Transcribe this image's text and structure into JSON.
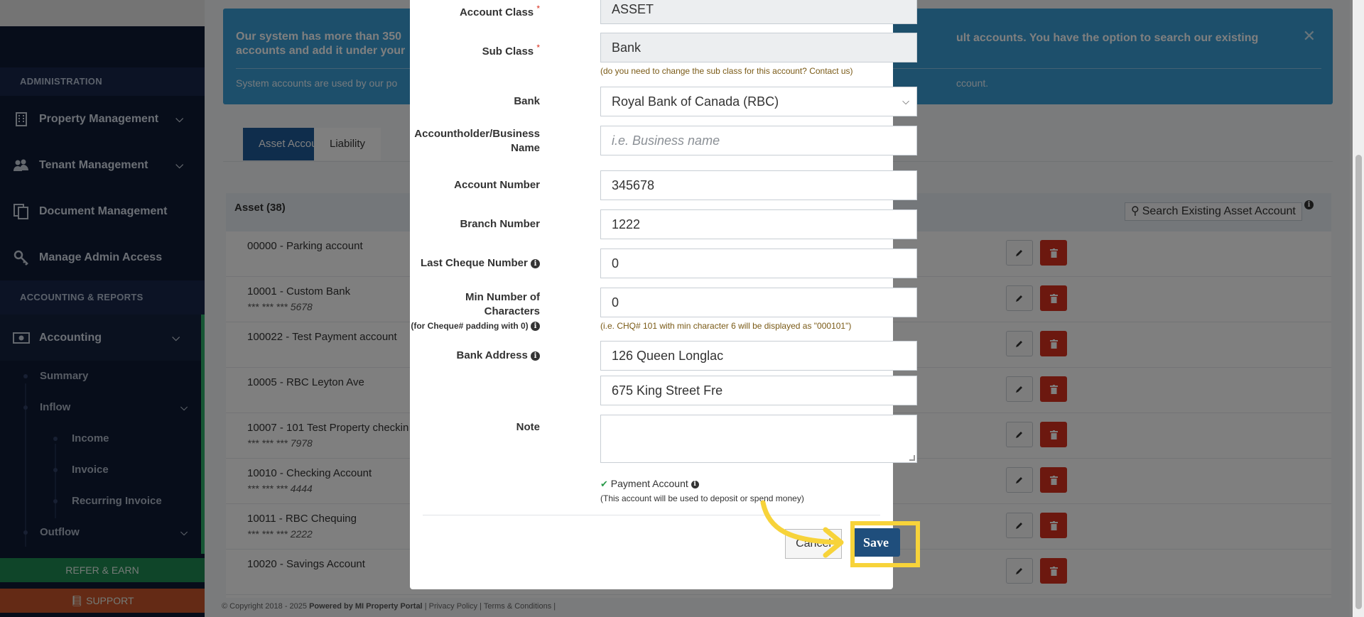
{
  "sidebar": {
    "admin_header": "ADMINISTRATION",
    "items": [
      {
        "label": "Property Management"
      },
      {
        "label": "Tenant Management"
      },
      {
        "label": "Document Management"
      },
      {
        "label": "Manage Admin Access"
      }
    ],
    "accounting_header": "ACCOUNTING & REPORTS",
    "accounting_label": "Accounting",
    "sub": {
      "summary": "Summary",
      "inflow": "Inflow",
      "income": "Income",
      "invoice": "Invoice",
      "recurring": "Recurring Invoice",
      "outflow": "Outflow"
    },
    "refer": "REFER & EARN",
    "support": "SUPPORT"
  },
  "alert": {
    "line1_left": "Our system has more than 350",
    "line1_left2": "accounts and add it under your",
    "line1_right": "ult accounts. You have the option to search our existing",
    "line2_left": "System accounts are used by our po",
    "line2_right": "ccount."
  },
  "tabs": {
    "asset": "Asset Accounts",
    "liability": "Liability"
  },
  "panel": {
    "title": "Asset (38)",
    "search": "Search Existing Asset Account",
    "rows": [
      {
        "name": "00000 - Parking account",
        "mask": ""
      },
      {
        "name": "10001 - Custom Bank",
        "mask": "*** *** *** 5678"
      },
      {
        "name": "100022 - Test Payment account",
        "mask": ""
      },
      {
        "name": "10005 - RBC Leyton Ave",
        "mask": ""
      },
      {
        "name": "10007 - 101 Test Property checkin",
        "mask": "*** *** *** 7978"
      },
      {
        "name": "10010 - Checking Account",
        "mask": "*** *** *** 4444"
      },
      {
        "name": "10011 - RBC Chequing",
        "mask": "*** *** *** 2222"
      },
      {
        "name": "10020 - Savings Account",
        "mask": ""
      }
    ]
  },
  "footer": {
    "copyright": "© Copyright 2018 - 2025",
    "powered": "Powered by MI Property Portal",
    "links": "| Privacy Policy | Terms & Conditions |"
  },
  "modal": {
    "account_class_label": "Account Class",
    "account_class_value": "ASSET",
    "sub_class_label": "Sub Class",
    "sub_class_value": "Bank",
    "sub_class_help": "(do you need to change the sub class for this account? Contact us)",
    "bank_label": "Bank",
    "bank_value": "Royal Bank of Canada (RBC)",
    "holder_label_1": "Accountholder/Business",
    "holder_label_2": "Name",
    "holder_placeholder": "i.e. Business name",
    "account_number_label": "Account Number",
    "account_number_value": "345678",
    "branch_label": "Branch Number",
    "branch_value": "1222",
    "cheque_label": "Last Cheque Number",
    "cheque_value": "0",
    "min_chars_label": "Min Number of Characters",
    "min_chars_sub": "(for Cheque# padding with 0)",
    "min_chars_value": "0",
    "min_chars_help": "(i.e. CHQ# 101 with min character 6 will be displayed as \"000101\")",
    "bank_address_label": "Bank Address",
    "bank_address_1": "126 Queen  Longlac",
    "bank_address_2": "675 King Street Fre",
    "note_label": "Note",
    "payment_label": "Payment Account",
    "payment_help": "(This account will be used to deposit or spend money)",
    "cancel": "Cancel",
    "save": "Save"
  },
  "colors": {
    "highlight": "#f7d33a",
    "save_bg": "#1f4e7c",
    "delete_bg": "#d9301f",
    "alert_bg": "#3a9fd6"
  }
}
